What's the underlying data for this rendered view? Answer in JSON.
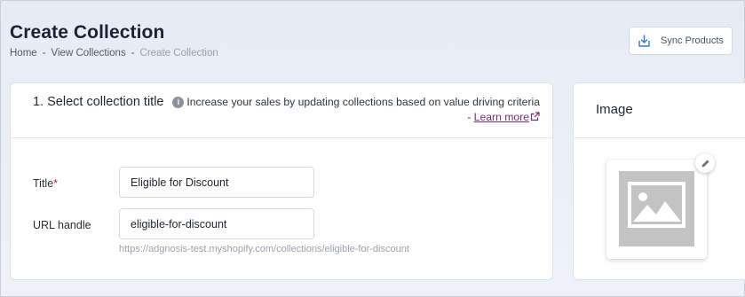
{
  "header": {
    "title": "Create Collection",
    "breadcrumb": {
      "home": "Home",
      "separator": "-",
      "view_collections": "View Collections",
      "current": "Create Collection"
    },
    "sync_button": {
      "label": "Sync Products",
      "icon": "download-icon"
    }
  },
  "select_title_section": {
    "title": "1. Select collection title",
    "hint": {
      "icon": "info-icon",
      "text": "Increase your sales by updating collections based on value driving criteria - ",
      "link_label": "Learn more",
      "link_icon": "external-link-icon",
      "link_color": "#7b2a7b"
    },
    "fields": {
      "title_label": "Title",
      "required_marker": "*",
      "title_value": "Eligible for Discount",
      "url_label": "URL handle",
      "url_value": "eligible-for-discount",
      "url_preview": "https://adgnosis-test.myshopify.com/collections/eligible-for-discount"
    }
  },
  "image_section": {
    "title": "Image",
    "placeholder_icon": "image-placeholder-icon",
    "edit_icon": "pencil-icon"
  }
}
